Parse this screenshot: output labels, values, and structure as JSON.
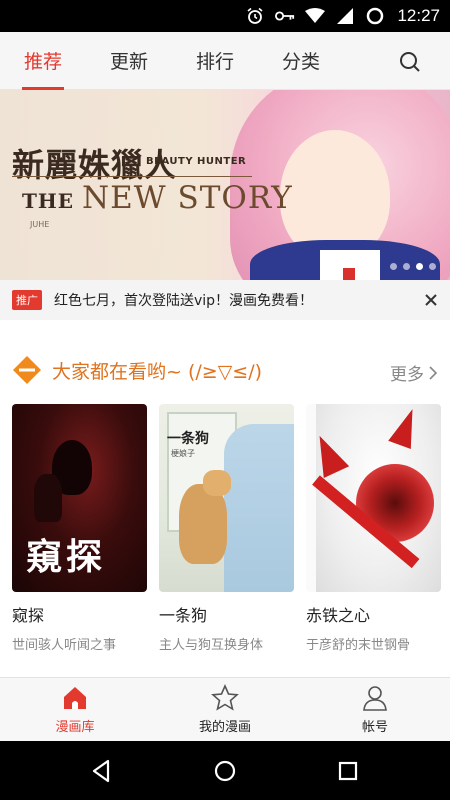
{
  "status_bar": {
    "time": "12:27"
  },
  "top_tabs": [
    {
      "label": "推荐",
      "active": true
    },
    {
      "label": "更新",
      "active": false
    },
    {
      "label": "排行",
      "active": false
    },
    {
      "label": "分类",
      "active": false
    }
  ],
  "banner": {
    "title_cn": "新麗姝獵人",
    "subtitle": "BEAUTY HUNTER",
    "the": "THE",
    "title_en": "NEW STORY",
    "brand": "JUHE",
    "active_dot": 3,
    "dot_count": 4
  },
  "notice": {
    "tag": "推广",
    "text": "红色七月，首次登陆送vip！漫画免费看！"
  },
  "section": {
    "title": "大家都在看哟~ (/≥▽≤/)",
    "more": "更多"
  },
  "comics": [
    {
      "name": "窥探",
      "desc": "世间骇人听闻之事",
      "cover_title": "窺探"
    },
    {
      "name": "一条狗",
      "desc": "主人与狗互换身体",
      "cover_title": "一条狗",
      "cover_author": "梗娘子"
    },
    {
      "name": "赤铁之心",
      "desc": "于彦舒的末世钢骨"
    }
  ],
  "bottom_nav": [
    {
      "label": "漫画库",
      "icon": "home-icon",
      "active": true
    },
    {
      "label": "我的漫画",
      "icon": "star-icon",
      "active": false
    },
    {
      "label": "帐号",
      "icon": "person-icon",
      "active": false
    }
  ],
  "colors": {
    "accent": "#e33a2f",
    "section_title": "#e0731f"
  }
}
